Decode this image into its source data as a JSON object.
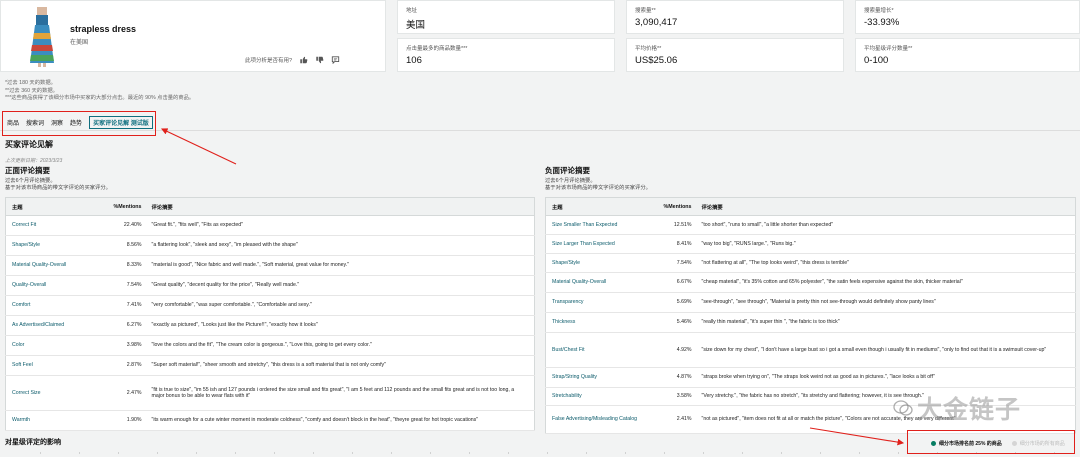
{
  "product": {
    "title": "strapless dress",
    "subtitle": "在美国",
    "feedback_question": "此项分析是否有用?"
  },
  "metrics": [
    {
      "label": "地址",
      "value": "美国"
    },
    {
      "label": "搜索量**",
      "value": "3,090,417"
    },
    {
      "label": "搜索量增长*",
      "value": "-33.93%"
    },
    {
      "label": "点击量最多的商品数量***",
      "value": "106"
    },
    {
      "label": "平均价格**",
      "value": "US$25.06"
    },
    {
      "label": "平均星级评分数量**",
      "value": "0-100"
    }
  ],
  "notes": [
    "*过去 180 天的数据。",
    "**过去 360 天的数据。",
    "***这些商品获得了该细分市场中买家的大部分点击。最近的 90% 点击量的商品。"
  ],
  "tabs": [
    {
      "label": "商品",
      "active": false
    },
    {
      "label": "搜索词",
      "active": false
    },
    {
      "label": "洞察",
      "active": false
    },
    {
      "label": "趋势",
      "active": false
    },
    {
      "label": "买家评论见解 测试版",
      "active": true
    }
  ],
  "section": {
    "title": "买家评论见解",
    "date": "上次更新日期：2023/3/23"
  },
  "positive": {
    "title": "正面评论摘要",
    "desc_1": "过去6个月评论摘要。",
    "desc_2": "基于对该市场商品的带文字评论的买家评分。",
    "headers": {
      "topic": "主题",
      "pct": "%Mentions",
      "summary": "评论摘要"
    },
    "rows": [
      {
        "topic": "Correct Fit",
        "pct": "22.40%",
        "summary": "\"Great fit.\", \"fits well\", \"Fits as expected\""
      },
      {
        "topic": "Shape/Style",
        "pct": "8.56%",
        "summary": "\"a flattering look\", \"sleek and sexy\", \"im pleased with the shape\""
      },
      {
        "topic": "Material Quality-Overall",
        "pct": "8.33%",
        "summary": "\"material is good\", \"Nice fabric and well made.\", \"Soft material, great value for money.\""
      },
      {
        "topic": "Quality-Overall",
        "pct": "7.54%",
        "summary": "\"Great quality\", \"decent quality for the price\", \"Really well made.\""
      },
      {
        "topic": "Comfort",
        "pct": "7.41%",
        "summary": "\"very comfortable\", \"was super comfortable.\", \"Comfortable and sexy.\""
      },
      {
        "topic": "As Advertised/Claimed",
        "pct": "6.27%",
        "summary": "\"exactly as pictured\", \"Looks just like the Picture!!\", \"exactly how it looks\""
      },
      {
        "topic": "Color",
        "pct": "3.98%",
        "summary": "\"love the colors and the fit\", \"The cream color is gorgeous.\", \"Love this, going to get every color.\""
      },
      {
        "topic": "Soft Feel",
        "pct": "2.87%",
        "summary": "\"Super soft material!\", \"sheer smooth and stretchy\", \"this dress is a soft material that is not only comfy\""
      },
      {
        "topic": "Correct Size",
        "pct": "2.47%",
        "summary": "\"fit is true to size\", \"im 55 ish and 127 pounds i ordered the size small and fits great\", \"I am 5 feet and 112 pounds and the small fits great and is not too long, a major bonus to be able to wear flats with it\""
      },
      {
        "topic": "Warmth",
        "pct": "1.90%",
        "summary": "\"its warm enough for a cute winter moment in moderate coldness\", \"comfy and doesn't block in the heat\", \"theyre great for hot tropic vacations\""
      }
    ]
  },
  "negative": {
    "title": "负面评论摘要",
    "desc_1": "过去6个月评论摘要。",
    "desc_2": "基于对该市场商品的带文字评论的买家评分。",
    "headers": {
      "topic": "主题",
      "pct": "%Mentions",
      "summary": "评论摘要"
    },
    "rows": [
      {
        "topic": "Size Smaller Than Expected",
        "pct": "12.51%",
        "summary": "\"too short\", \"runs to small\", \"a little shorter than expected\""
      },
      {
        "topic": "Size Larger Than Expected",
        "pct": "8.41%",
        "summary": "\"way too big\", \"RUNS large.\", \"Runs big.\""
      },
      {
        "topic": "Shape/Style",
        "pct": "7.54%",
        "summary": "\"not flattering at all\", \"The top looks weird\", \"this dress is terrible\""
      },
      {
        "topic": "Material Quality-Overall",
        "pct": "6.67%",
        "summary": "\"cheap material\", \"it's 35% cotton and 65% polyester\", \"the satin feels expensive against the skin, thicker material\""
      },
      {
        "topic": "Transparency",
        "pct": "5.69%",
        "summary": "\"see-through\", \"see through\", \"Material is pretty thin not see-through would definitely show panty lines\""
      },
      {
        "topic": "Thickness",
        "pct": "5.46%",
        "summary": "\"really thin material\", \"it's super thin \", \"the fabric is too thick\""
      },
      {
        "topic": "Bust/Chest Fit",
        "pct": "4.92%",
        "summary": "\"size down for my chest\", \"I don't have a large bust so i got a small even though i usually fit in mediums\", \"only to find out that it is a swimsuit cover-up\""
      },
      {
        "topic": "Strap/String Quality",
        "pct": "4.87%",
        "summary": "\"straps broke when trying on\", \"The straps look weird not as good as in pictures.\", \"lace looks a bit off\""
      },
      {
        "topic": "Stretchability",
        "pct": "3.58%",
        "summary": "\"Very stretchy.\", \"the fabric has no stretch\", \"its stretchy and flattering; however, it is see through.\""
      },
      {
        "topic": "False Advertising/Misleading Catalog",
        "pct": "2.41%",
        "summary": "\"not as pictured\", \"item does not fit at all or match the picture\", \"Colors are not accurate, they are very different\""
      }
    ]
  },
  "bottom": {
    "title": "对星级评定的影响",
    "legend_main": "细分市场排名前 25% 的商品",
    "legend_other": "细分市场的所有商品"
  },
  "watermark": {
    "text": "大金链子"
  },
  "colors": {
    "accent_teal": "#0f6f7f",
    "highlight_red": "#e0201b",
    "legend_green": "#067d62"
  }
}
